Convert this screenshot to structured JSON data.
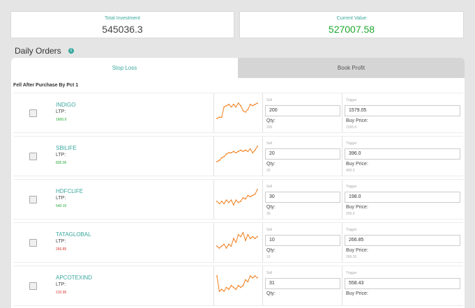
{
  "summary": {
    "total_investment_label": "Total Investment",
    "total_investment_value": "545036.3",
    "current_value_label": "Current Value",
    "current_value_value": "527007.58"
  },
  "section": {
    "title": "Daily Orders",
    "info_icon": "i"
  },
  "tabs": [
    {
      "label": "Stop Loss",
      "active": true
    },
    {
      "label": "Book Profit",
      "active": false
    }
  ],
  "subheader": "Fell After Purchase By Pct 1",
  "colors": {
    "accent": "#3aa89f",
    "positive": "#1ea82e",
    "negative": "#d9302b",
    "spark": "#f07f1d"
  },
  "rows": [
    {
      "symbol": "INDIGO",
      "ltp_label": "LTP:",
      "ltp": "1600.9",
      "trend": "up",
      "sell_label": "Sell",
      "sell": "200",
      "qty_label": "Qty:",
      "qty": "200",
      "trigger_label": "Trigger",
      "trigger": "1579.05",
      "buy_label": "Buy Price:",
      "buy_price": "1595.0",
      "spark": [
        3,
        4,
        4,
        12,
        13,
        14,
        12,
        14,
        12,
        15,
        13,
        9,
        8,
        10,
        14,
        13,
        14,
        15
      ]
    },
    {
      "symbol": "SBILIFE",
      "ltp_label": "LTP:",
      "ltp": "835.05",
      "trend": "up",
      "sell_label": "Sell",
      "sell": "20",
      "qty_label": "Qty:",
      "qty": "20",
      "trigger_label": "Trigger",
      "trigger": "396.0",
      "buy_label": "Buy Price:",
      "buy_price": "400.0",
      "spark": [
        2,
        3,
        5,
        6,
        8,
        9,
        9,
        10,
        9,
        10,
        11,
        10,
        11,
        10,
        12,
        9,
        11,
        14
      ]
    },
    {
      "symbol": "HDFCLIFE",
      "ltp_label": "LTP:",
      "ltp": "540.15",
      "trend": "up",
      "sell_label": "Sell",
      "sell": "30",
      "qty_label": "Qty:",
      "qty": "30",
      "trigger_label": "Trigger",
      "trigger": "198.0",
      "buy_label": "Buy Price:",
      "buy_price": "200.0",
      "spark": [
        5,
        3,
        5,
        3,
        6,
        4,
        6,
        2,
        6,
        4,
        5,
        8,
        7,
        10,
        9,
        10,
        11,
        15
      ]
    },
    {
      "symbol": "TATAGLOBAL",
      "ltp_label": "LTP:",
      "ltp": "266.85",
      "trend": "down",
      "sell_label": "Sell",
      "sell": "10",
      "qty_label": "Qty:",
      "qty": "10",
      "trigger_label": "Trigger",
      "trigger": "266.85",
      "buy_label": "Buy Price:",
      "buy_price": "269.55",
      "spark": [
        4,
        3,
        4,
        5,
        3,
        5,
        4,
        8,
        6,
        10,
        9,
        11,
        7,
        10,
        8,
        9,
        8,
        9
      ]
    },
    {
      "symbol": "APCOTEXIND",
      "ltp_label": "LTP:",
      "ltp": "210.95",
      "trend": "down",
      "sell_label": "Sell",
      "sell": "31",
      "qty_label": "Qty:",
      "qty": "",
      "trigger_label": "Trigger",
      "trigger": "558.43",
      "buy_label": "Buy Price:",
      "buy_price": "",
      "spark": [
        13,
        5,
        6,
        5,
        7,
        6,
        8,
        7,
        6,
        8,
        7,
        8,
        11,
        10,
        13,
        12,
        13,
        12
      ]
    }
  ]
}
